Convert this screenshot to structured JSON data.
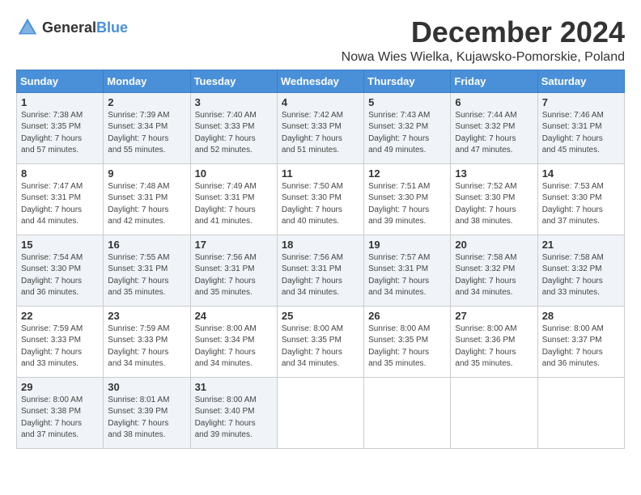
{
  "header": {
    "logo_general": "General",
    "logo_blue": "Blue",
    "month_title": "December 2024",
    "location": "Nowa Wies Wielka, Kujawsko-Pomorskie, Poland"
  },
  "days_of_week": [
    "Sunday",
    "Monday",
    "Tuesday",
    "Wednesday",
    "Thursday",
    "Friday",
    "Saturday"
  ],
  "weeks": [
    [
      {
        "day": "1",
        "sunrise": "Sunrise: 7:38 AM",
        "sunset": "Sunset: 3:35 PM",
        "daylight": "Daylight: 7 hours and 57 minutes."
      },
      {
        "day": "2",
        "sunrise": "Sunrise: 7:39 AM",
        "sunset": "Sunset: 3:34 PM",
        "daylight": "Daylight: 7 hours and 55 minutes."
      },
      {
        "day": "3",
        "sunrise": "Sunrise: 7:40 AM",
        "sunset": "Sunset: 3:33 PM",
        "daylight": "Daylight: 7 hours and 52 minutes."
      },
      {
        "day": "4",
        "sunrise": "Sunrise: 7:42 AM",
        "sunset": "Sunset: 3:33 PM",
        "daylight": "Daylight: 7 hours and 51 minutes."
      },
      {
        "day": "5",
        "sunrise": "Sunrise: 7:43 AM",
        "sunset": "Sunset: 3:32 PM",
        "daylight": "Daylight: 7 hours and 49 minutes."
      },
      {
        "day": "6",
        "sunrise": "Sunrise: 7:44 AM",
        "sunset": "Sunset: 3:32 PM",
        "daylight": "Daylight: 7 hours and 47 minutes."
      },
      {
        "day": "7",
        "sunrise": "Sunrise: 7:46 AM",
        "sunset": "Sunset: 3:31 PM",
        "daylight": "Daylight: 7 hours and 45 minutes."
      }
    ],
    [
      {
        "day": "8",
        "sunrise": "Sunrise: 7:47 AM",
        "sunset": "Sunset: 3:31 PM",
        "daylight": "Daylight: 7 hours and 44 minutes."
      },
      {
        "day": "9",
        "sunrise": "Sunrise: 7:48 AM",
        "sunset": "Sunset: 3:31 PM",
        "daylight": "Daylight: 7 hours and 42 minutes."
      },
      {
        "day": "10",
        "sunrise": "Sunrise: 7:49 AM",
        "sunset": "Sunset: 3:31 PM",
        "daylight": "Daylight: 7 hours and 41 minutes."
      },
      {
        "day": "11",
        "sunrise": "Sunrise: 7:50 AM",
        "sunset": "Sunset: 3:30 PM",
        "daylight": "Daylight: 7 hours and 40 minutes."
      },
      {
        "day": "12",
        "sunrise": "Sunrise: 7:51 AM",
        "sunset": "Sunset: 3:30 PM",
        "daylight": "Daylight: 7 hours and 39 minutes."
      },
      {
        "day": "13",
        "sunrise": "Sunrise: 7:52 AM",
        "sunset": "Sunset: 3:30 PM",
        "daylight": "Daylight: 7 hours and 38 minutes."
      },
      {
        "day": "14",
        "sunrise": "Sunrise: 7:53 AM",
        "sunset": "Sunset: 3:30 PM",
        "daylight": "Daylight: 7 hours and 37 minutes."
      }
    ],
    [
      {
        "day": "15",
        "sunrise": "Sunrise: 7:54 AM",
        "sunset": "Sunset: 3:30 PM",
        "daylight": "Daylight: 7 hours and 36 minutes."
      },
      {
        "day": "16",
        "sunrise": "Sunrise: 7:55 AM",
        "sunset": "Sunset: 3:31 PM",
        "daylight": "Daylight: 7 hours and 35 minutes."
      },
      {
        "day": "17",
        "sunrise": "Sunrise: 7:56 AM",
        "sunset": "Sunset: 3:31 PM",
        "daylight": "Daylight: 7 hours and 35 minutes."
      },
      {
        "day": "18",
        "sunrise": "Sunrise: 7:56 AM",
        "sunset": "Sunset: 3:31 PM",
        "daylight": "Daylight: 7 hours and 34 minutes."
      },
      {
        "day": "19",
        "sunrise": "Sunrise: 7:57 AM",
        "sunset": "Sunset: 3:31 PM",
        "daylight": "Daylight: 7 hours and 34 minutes."
      },
      {
        "day": "20",
        "sunrise": "Sunrise: 7:58 AM",
        "sunset": "Sunset: 3:32 PM",
        "daylight": "Daylight: 7 hours and 34 minutes."
      },
      {
        "day": "21",
        "sunrise": "Sunrise: 7:58 AM",
        "sunset": "Sunset: 3:32 PM",
        "daylight": "Daylight: 7 hours and 33 minutes."
      }
    ],
    [
      {
        "day": "22",
        "sunrise": "Sunrise: 7:59 AM",
        "sunset": "Sunset: 3:33 PM",
        "daylight": "Daylight: 7 hours and 33 minutes."
      },
      {
        "day": "23",
        "sunrise": "Sunrise: 7:59 AM",
        "sunset": "Sunset: 3:33 PM",
        "daylight": "Daylight: 7 hours and 34 minutes."
      },
      {
        "day": "24",
        "sunrise": "Sunrise: 8:00 AM",
        "sunset": "Sunset: 3:34 PM",
        "daylight": "Daylight: 7 hours and 34 minutes."
      },
      {
        "day": "25",
        "sunrise": "Sunrise: 8:00 AM",
        "sunset": "Sunset: 3:35 PM",
        "daylight": "Daylight: 7 hours and 34 minutes."
      },
      {
        "day": "26",
        "sunrise": "Sunrise: 8:00 AM",
        "sunset": "Sunset: 3:35 PM",
        "daylight": "Daylight: 7 hours and 35 minutes."
      },
      {
        "day": "27",
        "sunrise": "Sunrise: 8:00 AM",
        "sunset": "Sunset: 3:36 PM",
        "daylight": "Daylight: 7 hours and 35 minutes."
      },
      {
        "day": "28",
        "sunrise": "Sunrise: 8:00 AM",
        "sunset": "Sunset: 3:37 PM",
        "daylight": "Daylight: 7 hours and 36 minutes."
      }
    ],
    [
      {
        "day": "29",
        "sunrise": "Sunrise: 8:00 AM",
        "sunset": "Sunset: 3:38 PM",
        "daylight": "Daylight: 7 hours and 37 minutes."
      },
      {
        "day": "30",
        "sunrise": "Sunrise: 8:01 AM",
        "sunset": "Sunset: 3:39 PM",
        "daylight": "Daylight: 7 hours and 38 minutes."
      },
      {
        "day": "31",
        "sunrise": "Sunrise: 8:00 AM",
        "sunset": "Sunset: 3:40 PM",
        "daylight": "Daylight: 7 hours and 39 minutes."
      },
      null,
      null,
      null,
      null
    ]
  ]
}
